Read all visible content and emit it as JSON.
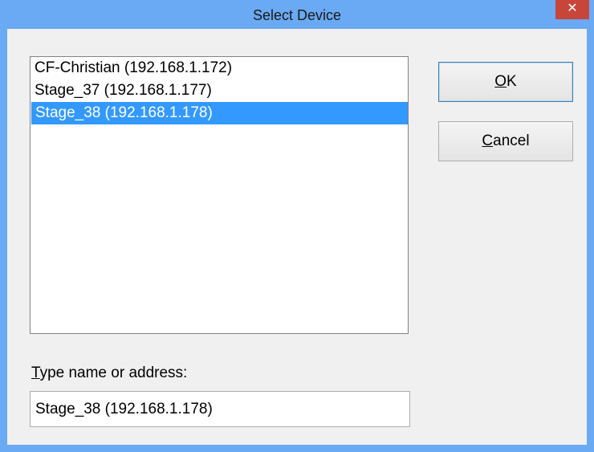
{
  "window": {
    "title": "Select Device",
    "close_glyph": "✕"
  },
  "device_list": {
    "items": [
      {
        "label": "CF-Christian (192.168.1.172)",
        "selected": false
      },
      {
        "label": "Stage_37 (192.168.1.177)",
        "selected": false
      },
      {
        "label": "Stage_38 (192.168.1.178)",
        "selected": true
      }
    ]
  },
  "name_field": {
    "label_accel": "T",
    "label_rest": "ype name or address:",
    "value": "Stage_38 (192.168.1.178)"
  },
  "buttons": {
    "ok_accel": "O",
    "ok_rest": "K",
    "cancel_accel": "C",
    "cancel_rest": "ancel"
  },
  "colors": {
    "titlebar": "#6aa9f3",
    "selection": "#3399ff",
    "close_button": "#c8453a"
  }
}
